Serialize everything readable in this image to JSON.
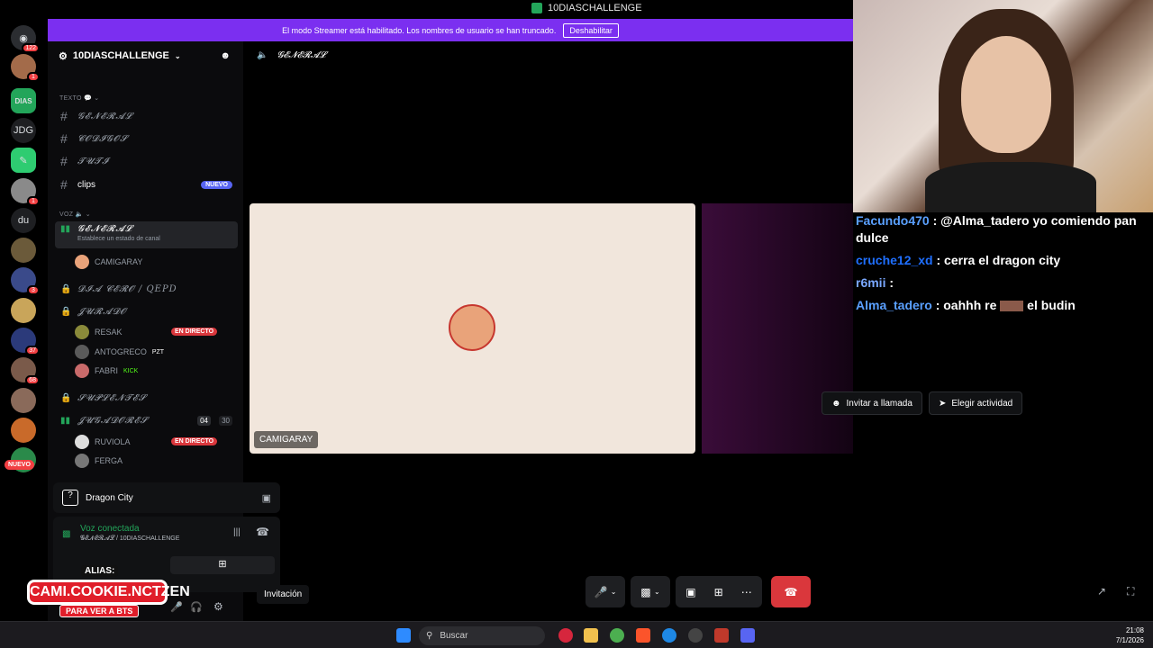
{
  "window": {
    "title": "10DIASCHALLENGE"
  },
  "banner": {
    "text": "El modo Streamer está habilitado. Los nombres de usuario se han truncado.",
    "button": "Deshabilitar"
  },
  "rail": {
    "badges": [
      "122",
      "1",
      "1",
      "3",
      "37",
      "68"
    ],
    "labels": {
      "jdg": "JDG",
      "du": "du",
      "dias": "DIAS"
    },
    "nuevo": "NUEVO"
  },
  "guild": {
    "name": "10DIASCHALLENGE"
  },
  "sidebar": {
    "cat_text": "TEXTO",
    "cat_voice": "VOZ",
    "text_channels": [
      "𝓖𝓔𝓝𝓔𝓡𝓐𝓛",
      "𝓒𝓞𝓓𝓘𝓖𝓞𝓢",
      "𝓣𝓤𝓣𝓘",
      "clips"
    ],
    "clips_pill": "NUEVO",
    "voice_general": "𝓖𝓔𝓝𝓔𝓡𝓐𝓛",
    "voice_general_sub": "Establece un estado de canal",
    "voice_user": "CAMIGARAY",
    "dia_cero": "𝓓𝓘𝓐 𝓒𝓔𝓡𝓞 / QEPD",
    "jurado": "𝓙𝓤𝓡𝓐𝓓𝓞",
    "jurado_users": [
      "RESAK",
      "ANTOGRECO",
      "FABRI"
    ],
    "en_directo": "EN DIRECTO",
    "antogreco_tag": "PZT",
    "fabri_tag": "KICK",
    "suplentes": "𝓢𝓤𝓟𝓛𝓔𝓝𝓣𝓔𝓢",
    "jugadores": "𝓙𝓤𝓖𝓐𝓓𝓞𝓡𝓔𝓢",
    "jugadores_count_a": "04",
    "jugadores_count_b": "30",
    "jugadores_users": [
      "RUVIOLA",
      "FERGA"
    ]
  },
  "activity": {
    "name": "Dragon City"
  },
  "voice": {
    "status": "Voz conectada",
    "channel": "𝓖𝓔𝓝𝓔𝓡𝓐𝓛 / 10DIASCHALLENGE"
  },
  "main": {
    "channel_name": "𝓖𝓔𝓝𝓔𝓡𝓐𝓛",
    "tile_label": "CAMIGARAY",
    "invite_call": "Invitar a llamada",
    "choose_activity": "Elegir actividad",
    "invitation": "Invitación"
  },
  "chat": [
    {
      "name": "Facundo470",
      "text": ": @Alma_tadero yo comiendo pan dulce"
    },
    {
      "name": "cruche12_xd",
      "text": ": cerra el dragon city"
    },
    {
      "name": "r6mii",
      "text": ":"
    },
    {
      "name": "Alma_tadero",
      "text": ": oahhh re",
      "tail": "el budin"
    }
  ],
  "alias": {
    "line1": "ALIAS:",
    "line2": "CAMI.COOKIE.NCTZEN",
    "line3": "PARA VER A BTS"
  },
  "taskbar": {
    "search": "Buscar",
    "time": "21:08",
    "date": "7/1/2026"
  },
  "colors": {
    "accent": "#7b2ff0",
    "live": "#da373c",
    "green": "#23a55a",
    "blurple": "#5865f2"
  }
}
